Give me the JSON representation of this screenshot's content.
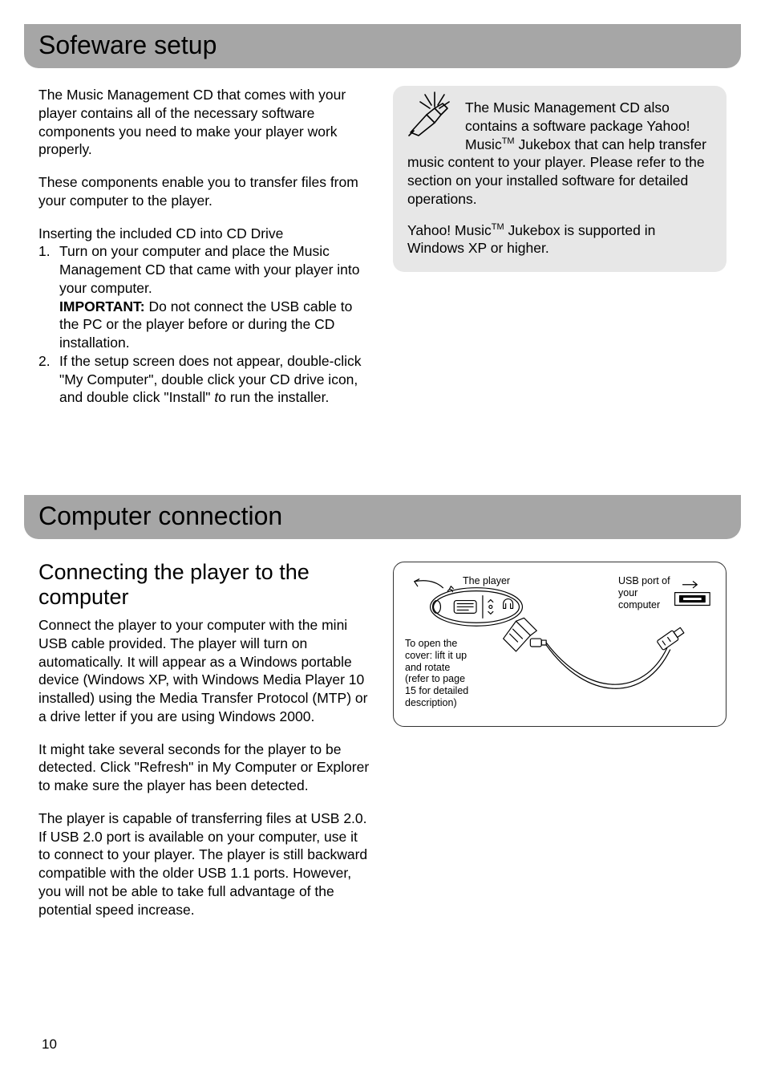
{
  "pageNumber": "10",
  "section1": {
    "title": "Sofeware setup",
    "left": {
      "p1": "The Music Management CD that comes with your player contains all of the necessary software components you need to make your player work properly.",
      "p2": "These components enable you to transfer files from your computer to the player.",
      "listHeading": "Inserting the included CD into CD Drive",
      "step1a": "Turn on your computer and place the Music Management CD that came with your player into your computer.",
      "importantLabel": "IMPORTANT:",
      "step1b": " Do not connect the USB cable to the PC or the player before or during the CD installation.",
      "step2a": "If the setup screen does not appear, double-click \"My Computer\", double click your CD drive icon, and double click \"Install\" ",
      "step2Italic": "t",
      "step2b": "o run the installer."
    },
    "right": {
      "note1a": "The Music Management CD also contains a software package Yahoo! Music",
      "tm": "TM",
      "note1b": " Jukebox that can help transfer music content to your player. Please refer to the section on your installed software for detailed operations.",
      "note2a": "Yahoo! Music",
      "note2b": " Jukebox is supported in Windows XP or higher."
    }
  },
  "section2": {
    "title": "Computer connection",
    "subHeading": "Connecting the player to the computer",
    "p1": "Connect the player to your computer with the mini USB cable provided.  The player will turn on automatically. It will appear as a Windows portable device (Windows XP, with Windows Media Player 10 installed) using the Media Transfer Protocol (MTP) or a drive letter if you are using Windows 2000.",
    "p2": "It might take several seconds for the player to be detected. Click \"Refresh\" in My Computer or Explorer to make sure the player has been detected.",
    "p3": "The player is capable of transferring files at USB 2.0.  If USB 2.0 port is available on your computer, use it to connect to your player. The player is still backward compatible with the older USB 1.1 ports. However, you will not be able to take full advantage of the potential speed increase.",
    "diagram": {
      "labelPlayer": "The player",
      "labelUsb": "USB port of your computer",
      "labelCover": "To open the cover: lift it up and rotate (refer to page 15 for detailed description)"
    }
  }
}
